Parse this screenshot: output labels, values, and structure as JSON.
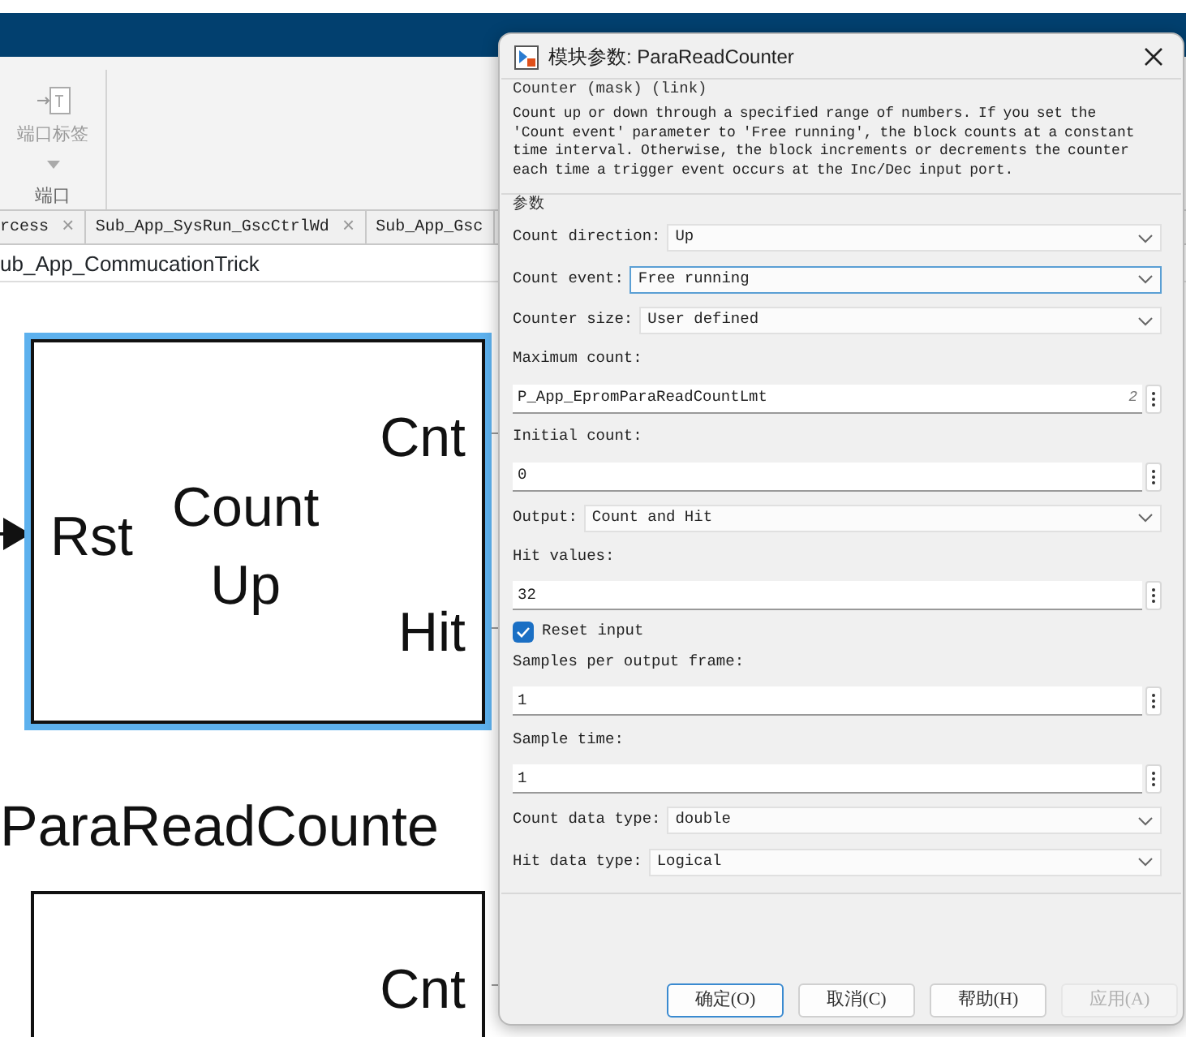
{
  "app": {
    "ribbon": {
      "button": "端口标签",
      "section": "端口"
    },
    "tabs": [
      {
        "label": "rcess",
        "close": "×"
      },
      {
        "label": "Sub_App_SysRun_GscCtrlWd",
        "close": "×"
      },
      {
        "label": "Sub_App_Gsc"
      }
    ],
    "breadcrumb": "ub_App_CommucationTrick",
    "blocks": [
      {
        "inputs": [
          "Rst"
        ],
        "outputs": [
          "Cnt",
          "Hit"
        ],
        "body": [
          "Count",
          "Up"
        ],
        "name": "ParaReadCounte",
        "selected": true
      },
      {
        "outputs": [
          "Cnt"
        ],
        "selected": false
      }
    ]
  },
  "dialog": {
    "title": "模块参数: ParaReadCounter",
    "mask_group": "Counter (mask) (link)",
    "description": "Count up or down through a specified range of numbers. If you set the 'Count event' parameter to 'Free running', the block counts at a constant time interval. Otherwise, the block increments or decrements the counter each time a trigger event occurs at the Inc/Dec input port.",
    "params_group": "参数",
    "params": [
      {
        "kind": "select",
        "label": "Count direction:",
        "value": "Up",
        "focused": false
      },
      {
        "kind": "select",
        "label": "Count event:",
        "value": "Free running",
        "focused": true
      },
      {
        "kind": "select",
        "label": "Counter size:",
        "value": "User defined",
        "focused": false
      },
      {
        "kind": "text",
        "label": "Maximum count:",
        "value": "P_App_EpromParaReadCountLmt",
        "badge": "2"
      },
      {
        "kind": "text",
        "label": "Initial count:",
        "value": "0"
      },
      {
        "kind": "select",
        "label": "Output:",
        "value": "Count and Hit",
        "focused": false
      },
      {
        "kind": "text",
        "label": "Hit values:",
        "value": "32"
      },
      {
        "kind": "checkbox",
        "label": "Reset input",
        "checked": true
      },
      {
        "kind": "text",
        "label": "Samples per output frame:",
        "value": "1"
      },
      {
        "kind": "text",
        "label": "Sample time:",
        "value": "1"
      },
      {
        "kind": "select",
        "label": "Count data type:",
        "value": "double",
        "focused": false
      },
      {
        "kind": "select",
        "label": "Hit data type:",
        "value": "Logical",
        "focused": false
      }
    ],
    "buttons": [
      {
        "label": "确定(O)",
        "focused": true,
        "disabled": false
      },
      {
        "label": "取消(C)",
        "focused": false,
        "disabled": false
      },
      {
        "label": "帮助(H)",
        "focused": false,
        "disabled": false
      },
      {
        "label": "应用(A)",
        "focused": false,
        "disabled": true
      }
    ]
  }
}
